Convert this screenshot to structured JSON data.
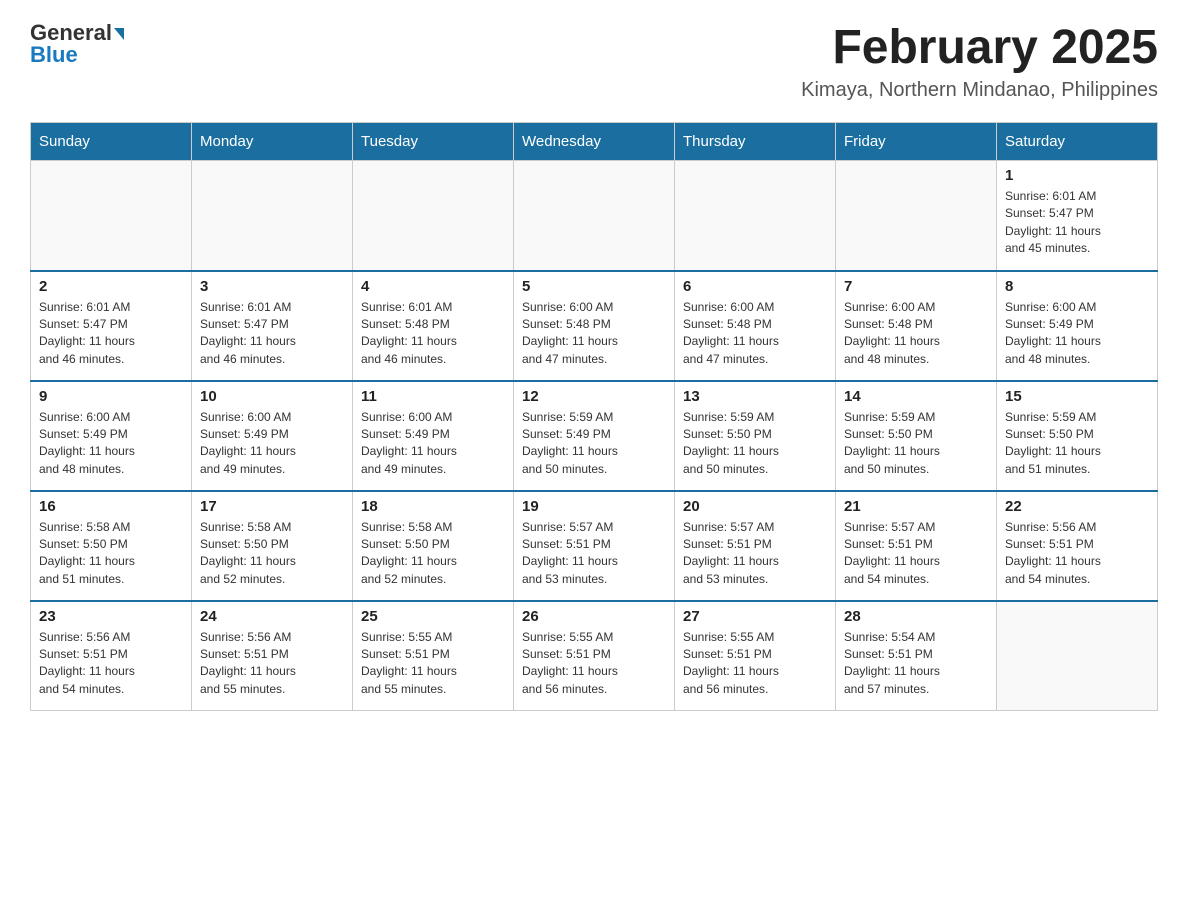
{
  "header": {
    "logo_general": "General",
    "logo_blue": "Blue",
    "title": "February 2025",
    "subtitle": "Kimaya, Northern Mindanao, Philippines"
  },
  "weekdays": [
    "Sunday",
    "Monday",
    "Tuesday",
    "Wednesday",
    "Thursday",
    "Friday",
    "Saturday"
  ],
  "weeks": [
    [
      {
        "day": "",
        "info": ""
      },
      {
        "day": "",
        "info": ""
      },
      {
        "day": "",
        "info": ""
      },
      {
        "day": "",
        "info": ""
      },
      {
        "day": "",
        "info": ""
      },
      {
        "day": "",
        "info": ""
      },
      {
        "day": "1",
        "info": "Sunrise: 6:01 AM\nSunset: 5:47 PM\nDaylight: 11 hours\nand 45 minutes."
      }
    ],
    [
      {
        "day": "2",
        "info": "Sunrise: 6:01 AM\nSunset: 5:47 PM\nDaylight: 11 hours\nand 46 minutes."
      },
      {
        "day": "3",
        "info": "Sunrise: 6:01 AM\nSunset: 5:47 PM\nDaylight: 11 hours\nand 46 minutes."
      },
      {
        "day": "4",
        "info": "Sunrise: 6:01 AM\nSunset: 5:48 PM\nDaylight: 11 hours\nand 46 minutes."
      },
      {
        "day": "5",
        "info": "Sunrise: 6:00 AM\nSunset: 5:48 PM\nDaylight: 11 hours\nand 47 minutes."
      },
      {
        "day": "6",
        "info": "Sunrise: 6:00 AM\nSunset: 5:48 PM\nDaylight: 11 hours\nand 47 minutes."
      },
      {
        "day": "7",
        "info": "Sunrise: 6:00 AM\nSunset: 5:48 PM\nDaylight: 11 hours\nand 48 minutes."
      },
      {
        "day": "8",
        "info": "Sunrise: 6:00 AM\nSunset: 5:49 PM\nDaylight: 11 hours\nand 48 minutes."
      }
    ],
    [
      {
        "day": "9",
        "info": "Sunrise: 6:00 AM\nSunset: 5:49 PM\nDaylight: 11 hours\nand 48 minutes."
      },
      {
        "day": "10",
        "info": "Sunrise: 6:00 AM\nSunset: 5:49 PM\nDaylight: 11 hours\nand 49 minutes."
      },
      {
        "day": "11",
        "info": "Sunrise: 6:00 AM\nSunset: 5:49 PM\nDaylight: 11 hours\nand 49 minutes."
      },
      {
        "day": "12",
        "info": "Sunrise: 5:59 AM\nSunset: 5:49 PM\nDaylight: 11 hours\nand 50 minutes."
      },
      {
        "day": "13",
        "info": "Sunrise: 5:59 AM\nSunset: 5:50 PM\nDaylight: 11 hours\nand 50 minutes."
      },
      {
        "day": "14",
        "info": "Sunrise: 5:59 AM\nSunset: 5:50 PM\nDaylight: 11 hours\nand 50 minutes."
      },
      {
        "day": "15",
        "info": "Sunrise: 5:59 AM\nSunset: 5:50 PM\nDaylight: 11 hours\nand 51 minutes."
      }
    ],
    [
      {
        "day": "16",
        "info": "Sunrise: 5:58 AM\nSunset: 5:50 PM\nDaylight: 11 hours\nand 51 minutes."
      },
      {
        "day": "17",
        "info": "Sunrise: 5:58 AM\nSunset: 5:50 PM\nDaylight: 11 hours\nand 52 minutes."
      },
      {
        "day": "18",
        "info": "Sunrise: 5:58 AM\nSunset: 5:50 PM\nDaylight: 11 hours\nand 52 minutes."
      },
      {
        "day": "19",
        "info": "Sunrise: 5:57 AM\nSunset: 5:51 PM\nDaylight: 11 hours\nand 53 minutes."
      },
      {
        "day": "20",
        "info": "Sunrise: 5:57 AM\nSunset: 5:51 PM\nDaylight: 11 hours\nand 53 minutes."
      },
      {
        "day": "21",
        "info": "Sunrise: 5:57 AM\nSunset: 5:51 PM\nDaylight: 11 hours\nand 54 minutes."
      },
      {
        "day": "22",
        "info": "Sunrise: 5:56 AM\nSunset: 5:51 PM\nDaylight: 11 hours\nand 54 minutes."
      }
    ],
    [
      {
        "day": "23",
        "info": "Sunrise: 5:56 AM\nSunset: 5:51 PM\nDaylight: 11 hours\nand 54 minutes."
      },
      {
        "day": "24",
        "info": "Sunrise: 5:56 AM\nSunset: 5:51 PM\nDaylight: 11 hours\nand 55 minutes."
      },
      {
        "day": "25",
        "info": "Sunrise: 5:55 AM\nSunset: 5:51 PM\nDaylight: 11 hours\nand 55 minutes."
      },
      {
        "day": "26",
        "info": "Sunrise: 5:55 AM\nSunset: 5:51 PM\nDaylight: 11 hours\nand 56 minutes."
      },
      {
        "day": "27",
        "info": "Sunrise: 5:55 AM\nSunset: 5:51 PM\nDaylight: 11 hours\nand 56 minutes."
      },
      {
        "day": "28",
        "info": "Sunrise: 5:54 AM\nSunset: 5:51 PM\nDaylight: 11 hours\nand 57 minutes."
      },
      {
        "day": "",
        "info": ""
      }
    ]
  ]
}
